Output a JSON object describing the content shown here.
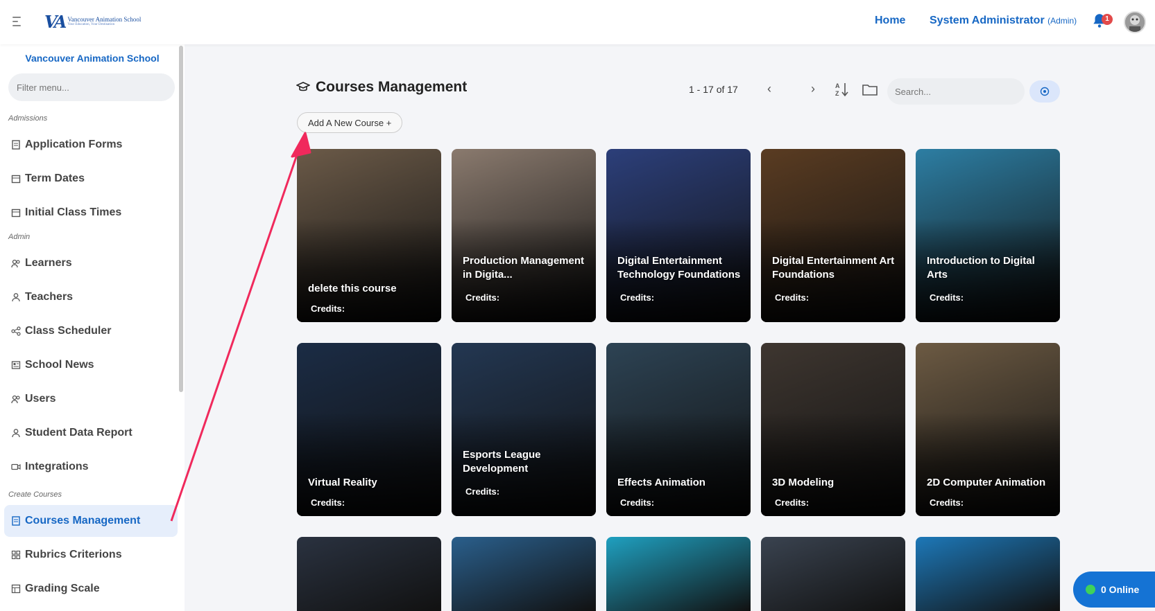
{
  "header": {
    "logo_name": "Vancouver Animation School",
    "logo_tag": "Your Education, Your Destination",
    "home": "Home",
    "admin_name": "System Administrator",
    "admin_role": "(Admin)",
    "notification_count": "1"
  },
  "sidebar": {
    "school": "Vancouver Animation School",
    "filter_placeholder": "Filter menu...",
    "sections": {
      "admissions": "Admissions",
      "admin": "Admin",
      "create": "Create Courses"
    },
    "items": [
      {
        "label": "Application Forms",
        "icon": "document-icon"
      },
      {
        "label": "Term Dates",
        "icon": "calendar-icon"
      },
      {
        "label": "Initial Class Times",
        "icon": "calendar-icon"
      },
      {
        "label": "Learners",
        "icon": "users-icon"
      },
      {
        "label": "Teachers",
        "icon": "user-icon"
      },
      {
        "label": "Class Scheduler",
        "icon": "share-icon"
      },
      {
        "label": "School News",
        "icon": "news-icon"
      },
      {
        "label": "Users",
        "icon": "users-icon"
      },
      {
        "label": "Student Data Report",
        "icon": "user-icon"
      },
      {
        "label": "Integrations",
        "icon": "video-icon"
      },
      {
        "label": "Courses Management",
        "icon": "document-icon"
      },
      {
        "label": "Rubrics Criterions",
        "icon": "grid-icon"
      },
      {
        "label": "Grading Scale",
        "icon": "table-icon"
      }
    ]
  },
  "main": {
    "title": "Courses Management",
    "pager": "1 - 17 of 17",
    "search_placeholder": "Search...",
    "add_button": "Add A New Course +",
    "credits_label": "Credits:",
    "courses": [
      {
        "title": "delete this course",
        "color": "#6b5a48"
      },
      {
        "title": "Production Management in Digita...",
        "color": "#8a7a6e"
      },
      {
        "title": "Digital Entertainment Technology Foundations",
        "color": "#2c3f7a"
      },
      {
        "title": "Digital Entertainment Art Foundations",
        "color": "#5a3c22"
      },
      {
        "title": "Introduction to Digital Arts",
        "color": "#2d7ea3"
      },
      {
        "title": "Virtual Reality",
        "color": "#1b2c45"
      },
      {
        "title": "Esports League Development",
        "color": "#233752"
      },
      {
        "title": "Effects Animation",
        "color": "#2d4354"
      },
      {
        "title": "3D Modeling",
        "color": "#3e3630"
      },
      {
        "title": "2D Computer Animation",
        "color": "#6c5a43"
      },
      {
        "title": "",
        "color": "#2a3240"
      },
      {
        "title": "",
        "color": "#2a5f8c"
      },
      {
        "title": "",
        "color": "#1fa0c0"
      },
      {
        "title": "",
        "color": "#3a4350"
      },
      {
        "title": "",
        "color": "#1d78b8"
      }
    ]
  },
  "online": "0 Online",
  "colors": {
    "accent": "#1667c4",
    "annotation_arrow": "#f0295c"
  }
}
